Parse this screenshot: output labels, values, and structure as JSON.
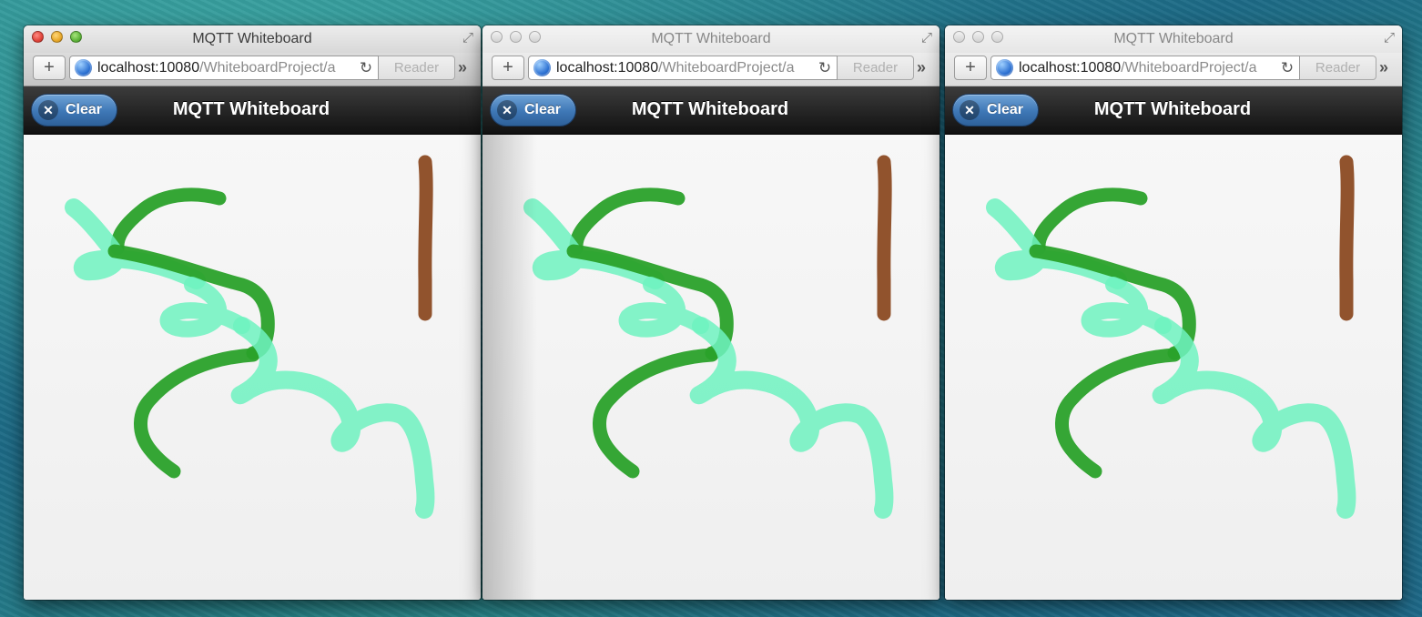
{
  "windows": [
    {
      "title": "MQTT Whiteboard",
      "url_host": "localhost:10080",
      "url_path": "/WhiteboardProject/a",
      "reader_label": "Reader",
      "app_title": "MQTT Whiteboard",
      "clear_label": "Clear",
      "active": true
    },
    {
      "title": "MQTT Whiteboard",
      "url_host": "localhost:10080",
      "url_path": "/WhiteboardProject/a",
      "reader_label": "Reader",
      "app_title": "MQTT Whiteboard",
      "clear_label": "Clear",
      "active": false
    },
    {
      "title": "MQTT Whiteboard",
      "url_host": "localhost:10080",
      "url_path": "/WhiteboardProject/a",
      "reader_label": "Reader",
      "app_title": "MQTT Whiteboard",
      "clear_label": "Clear",
      "active": false
    }
  ],
  "icons": {
    "close": "close-light",
    "minimize": "minimize-light",
    "zoom": "zoom-light",
    "fullscreen": "fullscreen-arrows-icon",
    "new_tab": "plus-icon",
    "site": "globe-icon",
    "reload": "reload-icon",
    "overflow": "chevron-double-right-icon",
    "clear": "x-circle-icon"
  },
  "colors": {
    "stroke_dark_green": "#2aa12a",
    "stroke_mint": "#6ff2c0",
    "stroke_brown": "#8b4a22",
    "clear_button": "#3e77b6"
  }
}
